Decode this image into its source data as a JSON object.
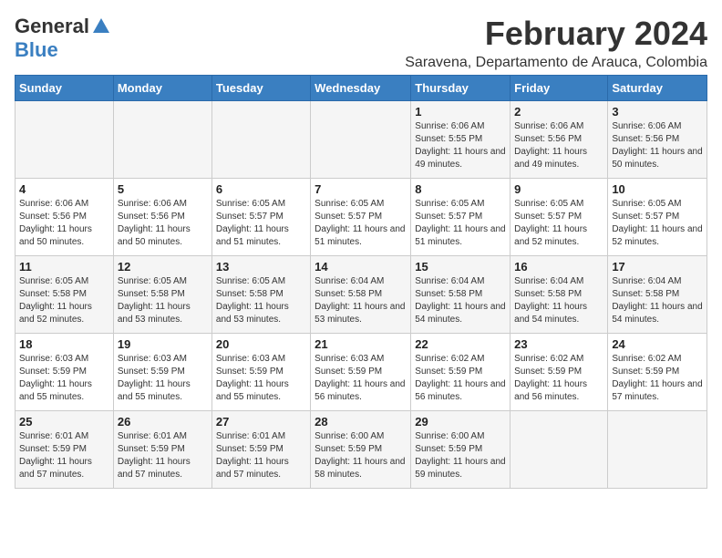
{
  "logo": {
    "general": "General",
    "blue": "Blue"
  },
  "title": "February 2024",
  "subtitle": "Saravena, Departamento de Arauca, Colombia",
  "days_of_week": [
    "Sunday",
    "Monday",
    "Tuesday",
    "Wednesday",
    "Thursday",
    "Friday",
    "Saturday"
  ],
  "weeks": [
    [
      {
        "num": "",
        "info": ""
      },
      {
        "num": "",
        "info": ""
      },
      {
        "num": "",
        "info": ""
      },
      {
        "num": "",
        "info": ""
      },
      {
        "num": "1",
        "info": "Sunrise: 6:06 AM\nSunset: 5:55 PM\nDaylight: 11 hours and 49 minutes."
      },
      {
        "num": "2",
        "info": "Sunrise: 6:06 AM\nSunset: 5:56 PM\nDaylight: 11 hours and 49 minutes."
      },
      {
        "num": "3",
        "info": "Sunrise: 6:06 AM\nSunset: 5:56 PM\nDaylight: 11 hours and 50 minutes."
      }
    ],
    [
      {
        "num": "4",
        "info": "Sunrise: 6:06 AM\nSunset: 5:56 PM\nDaylight: 11 hours and 50 minutes."
      },
      {
        "num": "5",
        "info": "Sunrise: 6:06 AM\nSunset: 5:56 PM\nDaylight: 11 hours and 50 minutes."
      },
      {
        "num": "6",
        "info": "Sunrise: 6:05 AM\nSunset: 5:57 PM\nDaylight: 11 hours and 51 minutes."
      },
      {
        "num": "7",
        "info": "Sunrise: 6:05 AM\nSunset: 5:57 PM\nDaylight: 11 hours and 51 minutes."
      },
      {
        "num": "8",
        "info": "Sunrise: 6:05 AM\nSunset: 5:57 PM\nDaylight: 11 hours and 51 minutes."
      },
      {
        "num": "9",
        "info": "Sunrise: 6:05 AM\nSunset: 5:57 PM\nDaylight: 11 hours and 52 minutes."
      },
      {
        "num": "10",
        "info": "Sunrise: 6:05 AM\nSunset: 5:57 PM\nDaylight: 11 hours and 52 minutes."
      }
    ],
    [
      {
        "num": "11",
        "info": "Sunrise: 6:05 AM\nSunset: 5:58 PM\nDaylight: 11 hours and 52 minutes."
      },
      {
        "num": "12",
        "info": "Sunrise: 6:05 AM\nSunset: 5:58 PM\nDaylight: 11 hours and 53 minutes."
      },
      {
        "num": "13",
        "info": "Sunrise: 6:05 AM\nSunset: 5:58 PM\nDaylight: 11 hours and 53 minutes."
      },
      {
        "num": "14",
        "info": "Sunrise: 6:04 AM\nSunset: 5:58 PM\nDaylight: 11 hours and 53 minutes."
      },
      {
        "num": "15",
        "info": "Sunrise: 6:04 AM\nSunset: 5:58 PM\nDaylight: 11 hours and 54 minutes."
      },
      {
        "num": "16",
        "info": "Sunrise: 6:04 AM\nSunset: 5:58 PM\nDaylight: 11 hours and 54 minutes."
      },
      {
        "num": "17",
        "info": "Sunrise: 6:04 AM\nSunset: 5:58 PM\nDaylight: 11 hours and 54 minutes."
      }
    ],
    [
      {
        "num": "18",
        "info": "Sunrise: 6:03 AM\nSunset: 5:59 PM\nDaylight: 11 hours and 55 minutes."
      },
      {
        "num": "19",
        "info": "Sunrise: 6:03 AM\nSunset: 5:59 PM\nDaylight: 11 hours and 55 minutes."
      },
      {
        "num": "20",
        "info": "Sunrise: 6:03 AM\nSunset: 5:59 PM\nDaylight: 11 hours and 55 minutes."
      },
      {
        "num": "21",
        "info": "Sunrise: 6:03 AM\nSunset: 5:59 PM\nDaylight: 11 hours and 56 minutes."
      },
      {
        "num": "22",
        "info": "Sunrise: 6:02 AM\nSunset: 5:59 PM\nDaylight: 11 hours and 56 minutes."
      },
      {
        "num": "23",
        "info": "Sunrise: 6:02 AM\nSunset: 5:59 PM\nDaylight: 11 hours and 56 minutes."
      },
      {
        "num": "24",
        "info": "Sunrise: 6:02 AM\nSunset: 5:59 PM\nDaylight: 11 hours and 57 minutes."
      }
    ],
    [
      {
        "num": "25",
        "info": "Sunrise: 6:01 AM\nSunset: 5:59 PM\nDaylight: 11 hours and 57 minutes."
      },
      {
        "num": "26",
        "info": "Sunrise: 6:01 AM\nSunset: 5:59 PM\nDaylight: 11 hours and 57 minutes."
      },
      {
        "num": "27",
        "info": "Sunrise: 6:01 AM\nSunset: 5:59 PM\nDaylight: 11 hours and 57 minutes."
      },
      {
        "num": "28",
        "info": "Sunrise: 6:00 AM\nSunset: 5:59 PM\nDaylight: 11 hours and 58 minutes."
      },
      {
        "num": "29",
        "info": "Sunrise: 6:00 AM\nSunset: 5:59 PM\nDaylight: 11 hours and 59 minutes."
      },
      {
        "num": "",
        "info": ""
      },
      {
        "num": "",
        "info": ""
      }
    ]
  ]
}
